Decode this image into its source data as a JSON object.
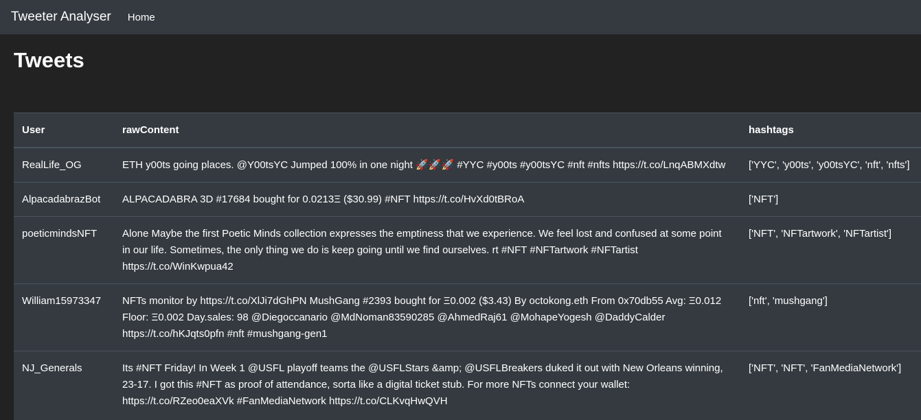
{
  "navbar": {
    "brand": "Tweeter Analyser",
    "links": [
      {
        "label": "Home"
      }
    ]
  },
  "page": {
    "title": "Tweets"
  },
  "table": {
    "columns": [
      "User",
      "rawContent",
      "hashtags"
    ],
    "rows": [
      {
        "user": "RealLife_OG",
        "content": "ETH y00ts going places. @Y00tsYC Jumped 100% in one night 🚀🚀🚀 #YYC #y00ts #y00tsYC #nft #nfts https://t.co/LnqABMXdtw",
        "hashtags": "['YYC', 'y00ts', 'y00tsYC', 'nft', 'nfts']"
      },
      {
        "user": "AlpacadabrazBot",
        "content": "ALPACADABRA 3D #17684 bought for 0.0213Ξ ($30.99) #NFT https://t.co/HvXd0tBRoA",
        "hashtags": "['NFT']"
      },
      {
        "user": "poeticmindsNFT",
        "content": "Alone Maybe the first Poetic Minds collection expresses the emptiness that we experience. We feel lost and confused at some point in our life. Sometimes, the only thing we do is keep going until we find ourselves. rt #NFT #NFTartwork #NFTartist https://t.co/WinKwpua42",
        "hashtags": "['NFT', 'NFTartwork', 'NFTartist']"
      },
      {
        "user": "William15973347",
        "content": "NFTs monitor by https://t.co/XlJi7dGhPN MushGang #2393 bought for Ξ0.002 ($3.43) By octokong.eth From 0x70db55 Avg: Ξ0.012 Floor: Ξ0.002 Day.sales: 98 @Diegoccanario @MdNoman83590285 @AhmedRaj61 @MohapeYogesh @DaddyCalder https://t.co/hKJqts0pfn #nft #mushgang-gen1",
        "hashtags": "['nft', 'mushgang']"
      },
      {
        "user": "NJ_Generals",
        "content": "Its #NFT Friday! In Week 1 @USFL playoff teams the @USFLStars &amp; @USFLBreakers duked it out with New Orleans winning, 23-17. I got this #NFT as proof of attendance, sorta like a digital ticket stub. For more NFTs connect your wallet: https://t.co/RZeo0eaXVk #FanMediaNetwork https://t.co/CLKvqHwQVH",
        "hashtags": "['NFT', 'NFT', 'FanMediaNetwork']"
      }
    ]
  }
}
